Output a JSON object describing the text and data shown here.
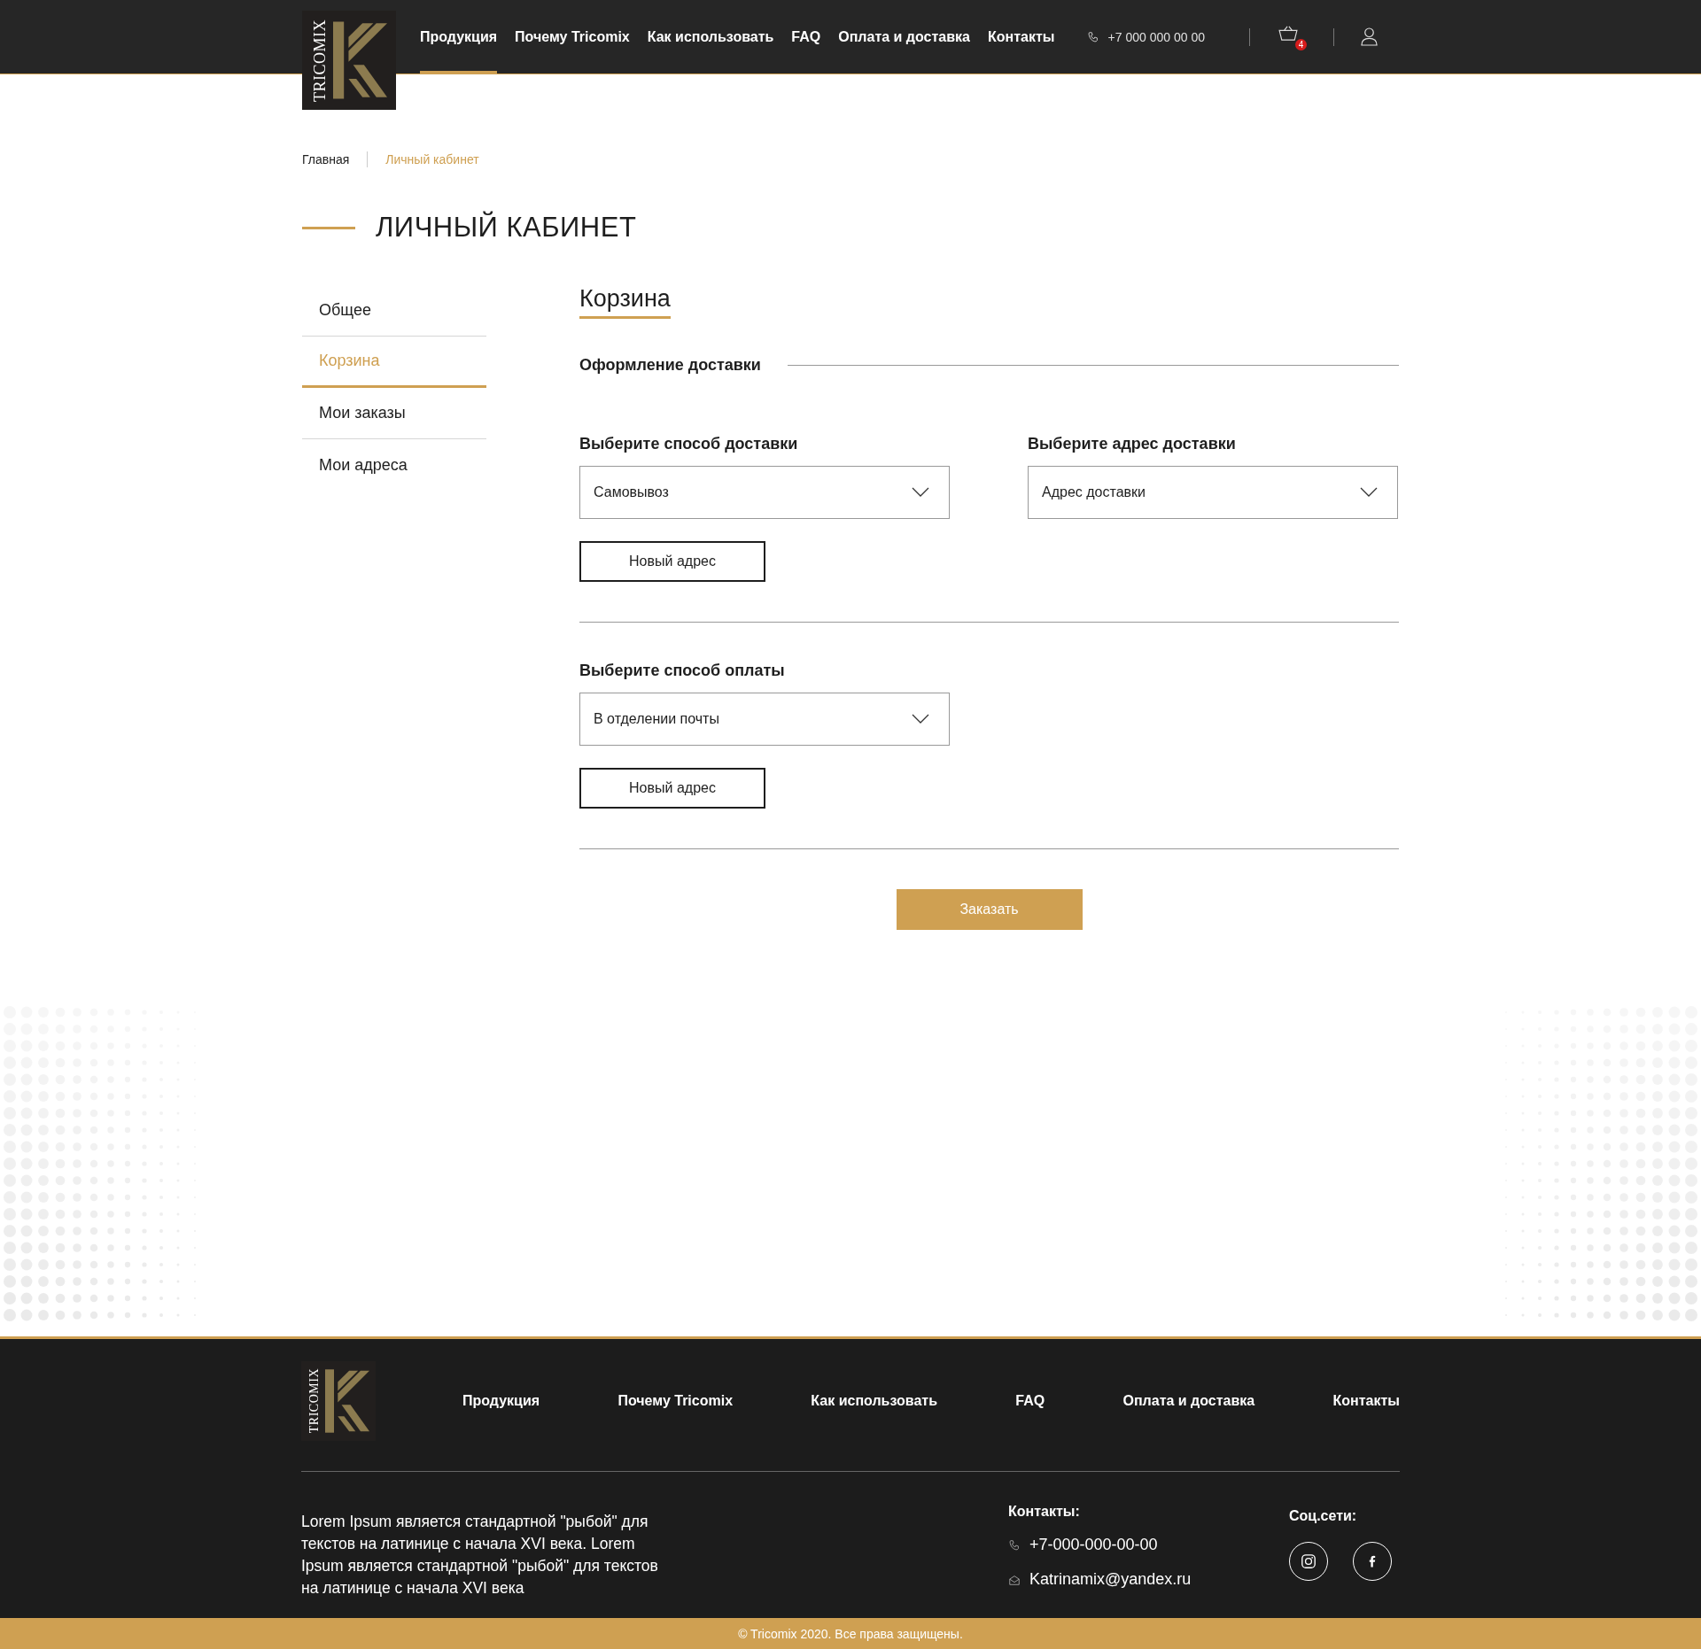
{
  "header": {
    "logo_text": "TRICOMIX",
    "nav": [
      {
        "label": "Продукция",
        "selected": true
      },
      {
        "label": "Почему Tricomix",
        "selected": false
      },
      {
        "label": "Как использовать",
        "selected": false
      },
      {
        "label": "FAQ",
        "selected": false
      },
      {
        "label": "Оплата и доставка",
        "selected": false
      },
      {
        "label": "Контакты",
        "selected": false
      }
    ],
    "phone": "+7 000 000 00 00",
    "cart_count": "4"
  },
  "breadcrumbs": [
    {
      "label": "Главная",
      "selected": false
    },
    {
      "label": "Личный кабинет",
      "selected": true
    }
  ],
  "page_title": "ЛИЧНЫЙ КАБИНЕТ",
  "sidebar": {
    "items": [
      {
        "label": "Общее",
        "selected": false
      },
      {
        "label": "Корзина",
        "selected": true
      },
      {
        "label": "Мои заказы",
        "selected": false
      },
      {
        "label": "Мои адреса",
        "selected": false
      }
    ]
  },
  "main": {
    "heading": "Корзина",
    "section_title": "Оформление доставки",
    "delivery_method": {
      "label": "Выберите способ доставки",
      "value": "Самовывоз",
      "button": "Новый адрес"
    },
    "delivery_address": {
      "label": "Выберите адрес доставки",
      "value": "Адрес доставки"
    },
    "payment": {
      "label": "Выберите способ оплаты",
      "value": "В отделении почты",
      "button": "Новый адрес"
    },
    "order_button": "Заказать"
  },
  "footer": {
    "logo_text": "TRICOMIX",
    "nav": [
      "Продукция",
      "Почему Tricomix",
      "Как использовать",
      "FAQ",
      "Оплата и доставка",
      "Контакты"
    ],
    "about": "Lorem Ipsum является стандартной \"рыбой\" для текстов на латинице с начала XVI века. Lorem Ipsum является стандартной \"рыбой\" для текстов на латинице с начала XVI века",
    "contacts_title": "Контакты:",
    "phone": "+7-000-000-00-00",
    "email": "Katrinamix@yandex.ru",
    "social_title": "Соц.сети:",
    "copyright": "© Tricomix 2020. Все права защищены."
  }
}
